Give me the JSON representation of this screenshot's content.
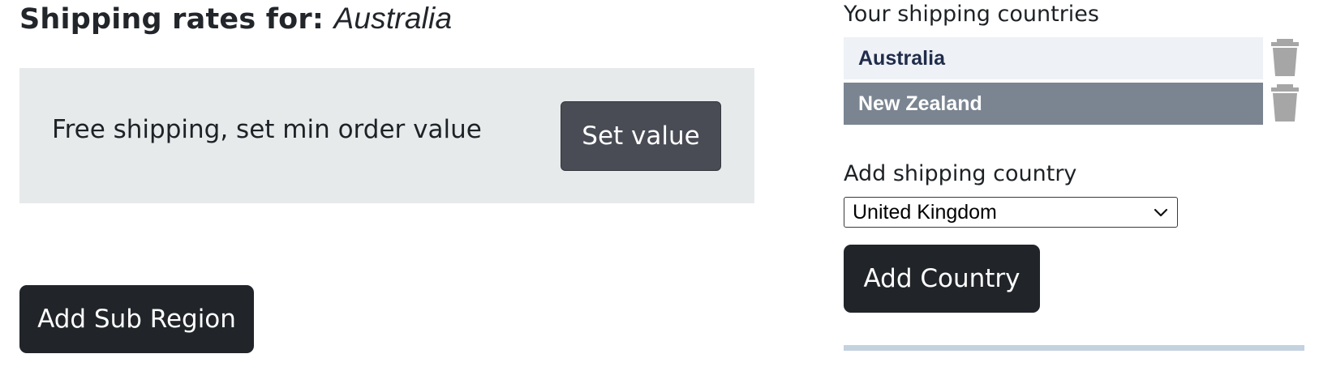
{
  "header": {
    "title_prefix": "Shipping rates for:",
    "title_country": "Australia"
  },
  "rate_panel": {
    "text": "Free shipping, set min order value",
    "button_label": "Set value"
  },
  "sub_region": {
    "button_label": "Add Sub Region"
  },
  "sidebar": {
    "countries_heading": "Your shipping countries",
    "countries": [
      {
        "label": "Australia",
        "selected": false
      },
      {
        "label": "New Zealand",
        "selected": true
      }
    ],
    "add_heading": "Add shipping country",
    "select_value": "United Kingdom",
    "add_button_label": "Add Country"
  },
  "colors": {
    "primary_button": "#212529",
    "secondary_button": "#494c55",
    "panel_bg": "#e7eaeb",
    "row_light": "#eef1f6",
    "row_selected": "#7a8591",
    "trash_icon": "#a6a6a6",
    "divider": "#c3d2de"
  },
  "icons": {
    "delete": "trash-icon",
    "dropdown": "chevron-down-icon"
  }
}
